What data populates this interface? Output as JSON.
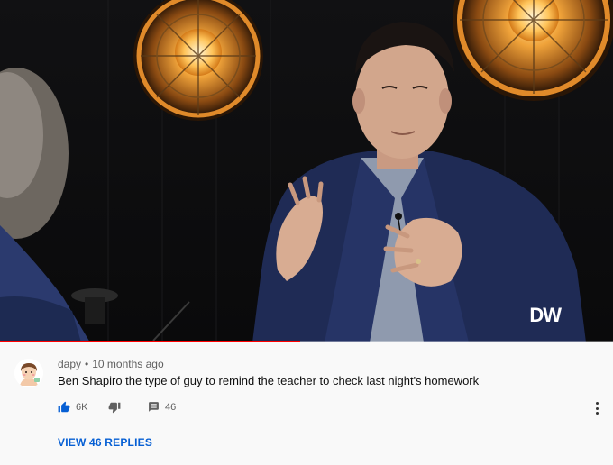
{
  "video": {
    "watermark": "DW",
    "progress_fraction": 0.49,
    "progress_color": "#ff0000"
  },
  "comment": {
    "author": "dapy",
    "separator": "•",
    "time": "10 months ago",
    "text": "Ben Shapiro the type of guy to remind the teacher to check last night's homework",
    "likes": "6K",
    "replies_count": "46",
    "view_replies_label": "VIEW 46 REPLIES",
    "icons": {
      "like": "thumbs-up-icon",
      "dislike": "thumbs-down-icon",
      "reply": "reply-icon",
      "more": "more-vertical-icon"
    },
    "accent_color": "#065fd4"
  }
}
